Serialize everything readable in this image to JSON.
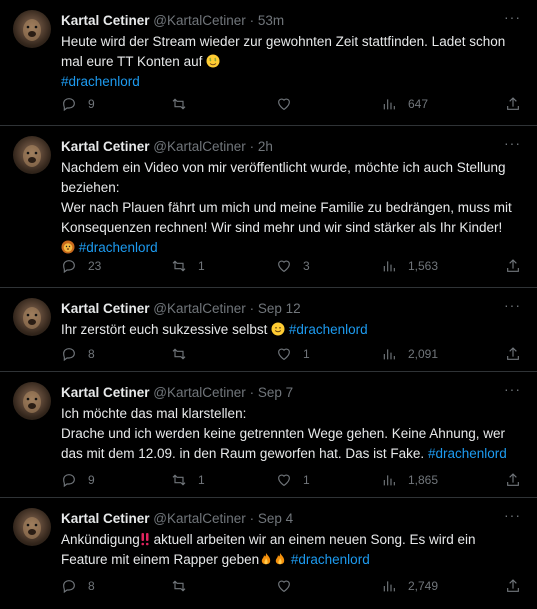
{
  "tweets": [
    {
      "name": "Kartal Cetiner",
      "handle": "@KartalCetiner",
      "dot": "·",
      "time": "53m",
      "lines": [
        "Heute wird der Stream wieder zur gewohnten Zeit stattfinden. Ladet schon",
        "mal eure TT Konten auf"
      ],
      "hashtag": "#drachenlord",
      "replies": "9",
      "retweets": "",
      "likes": "",
      "views": "647"
    },
    {
      "name": "Kartal Cetiner",
      "handle": "@KartalCetiner",
      "dot": "·",
      "time": "2h",
      "lines": [
        "Nachdem ein Video von mir veröffentlicht wurde, möchte ich auch Stellung",
        "beziehen:",
        "Wer nach Plauen fährt um mich und meine Familie zu bedrängen, muss mit",
        "Konsequenzen rechnen! Wir sind mehr und wir sind stärker als Ihr Kinder!"
      ],
      "hashtag": "#drachenlord",
      "replies": "23",
      "retweets": "1",
      "likes": "3",
      "views": "1,563"
    },
    {
      "name": "Kartal Cetiner",
      "handle": "@KartalCetiner",
      "dot": "·",
      "time": "Sep 12",
      "lines": [
        "Ihr zerstört euch sukzessive selbst"
      ],
      "hashtag": "#drachenlord",
      "replies": "8",
      "retweets": "",
      "likes": "1",
      "views": "2,091"
    },
    {
      "name": "Kartal Cetiner",
      "handle": "@KartalCetiner",
      "dot": "·",
      "time": "Sep 7",
      "lines": [
        "Ich möchte das mal klarstellen:",
        "Drache und ich werden keine getrennten Wege gehen. Keine Ahnung, wer",
        "das mit dem 12.09. in den Raum geworfen hat. Das ist Fake."
      ],
      "hashtag": "#drachenlord",
      "replies": "9",
      "retweets": "1",
      "likes": "1",
      "views": "1,865"
    },
    {
      "name": "Kartal Cetiner",
      "handle": "@KartalCetiner",
      "dot": "·",
      "time": "Sep 4",
      "lines": [
        "Ankündigung",
        "aktuell arbeiten wir an einem neuen Song. Es wird ein",
        "Feature mit einem Rapper geben"
      ],
      "hashtag": "#drachenlord",
      "replies": "8",
      "retweets": "",
      "likes": "",
      "views": "2,749"
    }
  ],
  "icons": [
    "more-icon",
    "reply-icon",
    "retweet-icon",
    "like-icon",
    "views-icon",
    "share-icon"
  ],
  "colors": {
    "background": "#000000",
    "text": "#e7e9ea",
    "muted": "#71767b",
    "link": "#1d9bf0",
    "divider": "#2f3336"
  }
}
